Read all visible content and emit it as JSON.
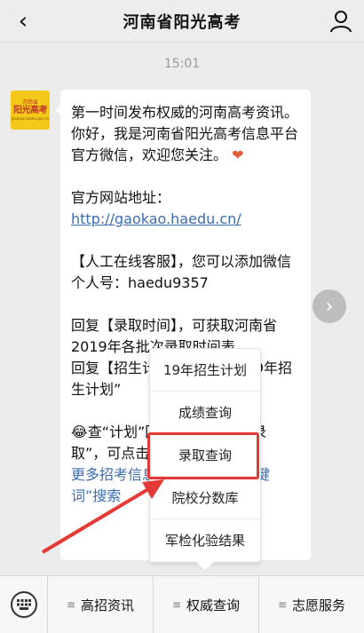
{
  "nav": {
    "back_icon": "chevron-left-icon",
    "title": "河南省阳光高考",
    "profile_icon": "user-icon"
  },
  "timestamp": "15:01",
  "avatar": {
    "line1": "河南省",
    "line2": "阳光高考",
    "line3": "gaokao.haedu.gov.cn"
  },
  "message": {
    "p1": "第一时间发布权威的河南高考资讯。你好，我是河南省阳光高考信息平台官方微信，欢迎您关注。",
    "heart": "❤",
    "p2_label": "官方网站地址：",
    "p2_link": "http://gaokao.haedu.cn/",
    "p3": "【人工在线客服】，您可以添加微信个人号：haedu9357",
    "p4": "回复【录取时间】，可获取河南省2019年各批次录取时间表。",
    "p5": "回复【招生计划】，查询“2019年招生计划”",
    "p6": "😂查“计划”回复“计划”，查“录取”，可点击下方菜单栏哟~",
    "more": "更多招考信息可以回复输入关键词”搜索"
  },
  "popup_menu": [
    "19年招生计划",
    "成绩查询",
    "录取查询",
    "院校分数库",
    "军检化验结果"
  ],
  "bottom_menu": {
    "keyboard_icon": "keyboard-icon",
    "items": [
      "高招资讯",
      "权威查询",
      "志愿服务"
    ]
  },
  "colors": {
    "accent_link": "#3b6cb4",
    "highlight": "#e53935",
    "avatar_bg": "#f5c91a"
  }
}
